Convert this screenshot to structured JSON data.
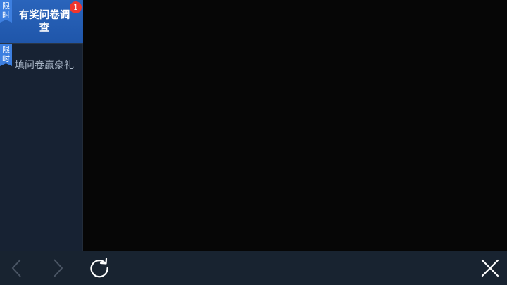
{
  "sidebar": {
    "items": [
      {
        "tag": "限\n时",
        "label": "有奖问卷调查",
        "badge": "1",
        "active": true
      },
      {
        "tag": "限\n时",
        "label": "填问卷赢豪礼",
        "active": false
      }
    ]
  },
  "toolbar": {
    "back_icon": "chevron-left-icon",
    "forward_icon": "chevron-right-icon",
    "refresh_icon": "refresh-icon",
    "close_icon": "close-icon"
  },
  "colors": {
    "accent": "#2a64bb",
    "badge": "#f0362e",
    "tag": "#3d7fe0",
    "sidebar_bg": "#172233",
    "toolbar_bg": "#182330"
  }
}
